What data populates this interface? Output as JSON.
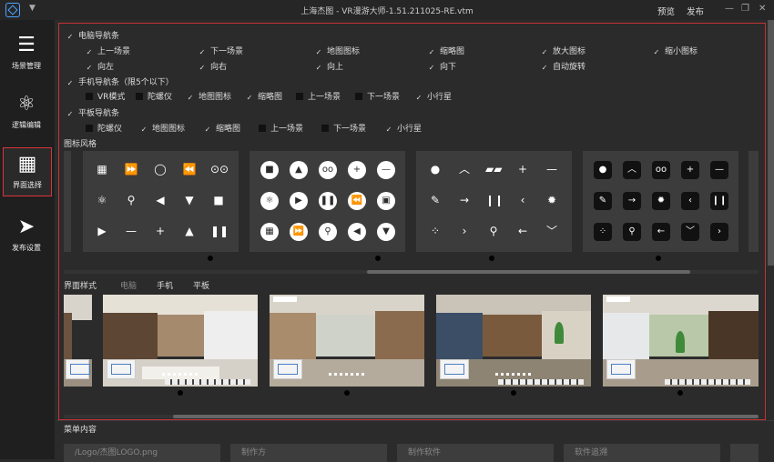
{
  "window": {
    "title": "上海杰图 - VR漫游大师-1.51.211025-RE.vtm",
    "preview": "预览",
    "publish": "发布"
  },
  "sidebar": [
    {
      "label": "场景管理",
      "icon": "menu-icon"
    },
    {
      "label": "逻辑编辑",
      "icon": "atom-icon"
    },
    {
      "label": "界面选择",
      "icon": "grid-icon"
    },
    {
      "label": "发布设置",
      "icon": "send-icon"
    }
  ],
  "pc_nav": {
    "label": "电脑导航条",
    "items": [
      "上一场景",
      "下一场景",
      "地图图标",
      "缩略图",
      "放大图标",
      "缩小图标",
      "向左",
      "向右",
      "向上",
      "向下",
      "自动旋转"
    ]
  },
  "mobile_nav": {
    "label": "手机导航条（限5个以下）",
    "items": [
      "VR模式",
      "陀螺仪",
      "地图图标",
      "缩略图",
      "上一场景",
      "下一场景",
      "小行星"
    ],
    "checked": [
      false,
      false,
      true,
      true,
      false,
      false,
      true
    ]
  },
  "tablet_nav": {
    "label": "平板导航条",
    "items": [
      "陀螺仪",
      "地图图标",
      "缩略图",
      "上一场景",
      "下一场景",
      "小行星"
    ],
    "checked": [
      false,
      true,
      true,
      false,
      false,
      true
    ]
  },
  "icon_style": {
    "label": "图标风格"
  },
  "ui_style": {
    "label": "界面样式",
    "tabs": [
      "电脑",
      "手机",
      "平板"
    ]
  },
  "menu_content": {
    "label": "菜单内容",
    "fields": [
      "/Logo/杰图LOGO.png",
      "制作方",
      "制作软件",
      "软件追溯"
    ]
  }
}
